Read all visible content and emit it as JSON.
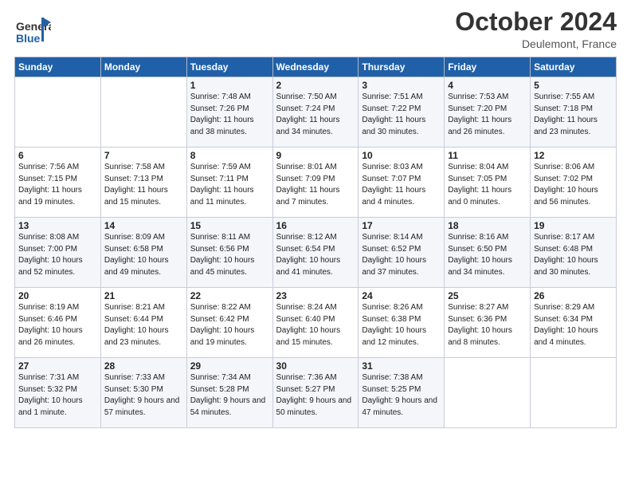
{
  "header": {
    "logo_general": "General",
    "logo_blue": "Blue",
    "month_title": "October 2024",
    "location": "Deulemont, France"
  },
  "weekdays": [
    "Sunday",
    "Monday",
    "Tuesday",
    "Wednesday",
    "Thursday",
    "Friday",
    "Saturday"
  ],
  "weeks": [
    [
      {
        "day": "",
        "sunrise": "",
        "sunset": "",
        "daylight": ""
      },
      {
        "day": "",
        "sunrise": "",
        "sunset": "",
        "daylight": ""
      },
      {
        "day": "1",
        "sunrise": "Sunrise: 7:48 AM",
        "sunset": "Sunset: 7:26 PM",
        "daylight": "Daylight: 11 hours and 38 minutes."
      },
      {
        "day": "2",
        "sunrise": "Sunrise: 7:50 AM",
        "sunset": "Sunset: 7:24 PM",
        "daylight": "Daylight: 11 hours and 34 minutes."
      },
      {
        "day": "3",
        "sunrise": "Sunrise: 7:51 AM",
        "sunset": "Sunset: 7:22 PM",
        "daylight": "Daylight: 11 hours and 30 minutes."
      },
      {
        "day": "4",
        "sunrise": "Sunrise: 7:53 AM",
        "sunset": "Sunset: 7:20 PM",
        "daylight": "Daylight: 11 hours and 26 minutes."
      },
      {
        "day": "5",
        "sunrise": "Sunrise: 7:55 AM",
        "sunset": "Sunset: 7:18 PM",
        "daylight": "Daylight: 11 hours and 23 minutes."
      }
    ],
    [
      {
        "day": "6",
        "sunrise": "Sunrise: 7:56 AM",
        "sunset": "Sunset: 7:15 PM",
        "daylight": "Daylight: 11 hours and 19 minutes."
      },
      {
        "day": "7",
        "sunrise": "Sunrise: 7:58 AM",
        "sunset": "Sunset: 7:13 PM",
        "daylight": "Daylight: 11 hours and 15 minutes."
      },
      {
        "day": "8",
        "sunrise": "Sunrise: 7:59 AM",
        "sunset": "Sunset: 7:11 PM",
        "daylight": "Daylight: 11 hours and 11 minutes."
      },
      {
        "day": "9",
        "sunrise": "Sunrise: 8:01 AM",
        "sunset": "Sunset: 7:09 PM",
        "daylight": "Daylight: 11 hours and 7 minutes."
      },
      {
        "day": "10",
        "sunrise": "Sunrise: 8:03 AM",
        "sunset": "Sunset: 7:07 PM",
        "daylight": "Daylight: 11 hours and 4 minutes."
      },
      {
        "day": "11",
        "sunrise": "Sunrise: 8:04 AM",
        "sunset": "Sunset: 7:05 PM",
        "daylight": "Daylight: 11 hours and 0 minutes."
      },
      {
        "day": "12",
        "sunrise": "Sunrise: 8:06 AM",
        "sunset": "Sunset: 7:02 PM",
        "daylight": "Daylight: 10 hours and 56 minutes."
      }
    ],
    [
      {
        "day": "13",
        "sunrise": "Sunrise: 8:08 AM",
        "sunset": "Sunset: 7:00 PM",
        "daylight": "Daylight: 10 hours and 52 minutes."
      },
      {
        "day": "14",
        "sunrise": "Sunrise: 8:09 AM",
        "sunset": "Sunset: 6:58 PM",
        "daylight": "Daylight: 10 hours and 49 minutes."
      },
      {
        "day": "15",
        "sunrise": "Sunrise: 8:11 AM",
        "sunset": "Sunset: 6:56 PM",
        "daylight": "Daylight: 10 hours and 45 minutes."
      },
      {
        "day": "16",
        "sunrise": "Sunrise: 8:12 AM",
        "sunset": "Sunset: 6:54 PM",
        "daylight": "Daylight: 10 hours and 41 minutes."
      },
      {
        "day": "17",
        "sunrise": "Sunrise: 8:14 AM",
        "sunset": "Sunset: 6:52 PM",
        "daylight": "Daylight: 10 hours and 37 minutes."
      },
      {
        "day": "18",
        "sunrise": "Sunrise: 8:16 AM",
        "sunset": "Sunset: 6:50 PM",
        "daylight": "Daylight: 10 hours and 34 minutes."
      },
      {
        "day": "19",
        "sunrise": "Sunrise: 8:17 AM",
        "sunset": "Sunset: 6:48 PM",
        "daylight": "Daylight: 10 hours and 30 minutes."
      }
    ],
    [
      {
        "day": "20",
        "sunrise": "Sunrise: 8:19 AM",
        "sunset": "Sunset: 6:46 PM",
        "daylight": "Daylight: 10 hours and 26 minutes."
      },
      {
        "day": "21",
        "sunrise": "Sunrise: 8:21 AM",
        "sunset": "Sunset: 6:44 PM",
        "daylight": "Daylight: 10 hours and 23 minutes."
      },
      {
        "day": "22",
        "sunrise": "Sunrise: 8:22 AM",
        "sunset": "Sunset: 6:42 PM",
        "daylight": "Daylight: 10 hours and 19 minutes."
      },
      {
        "day": "23",
        "sunrise": "Sunrise: 8:24 AM",
        "sunset": "Sunset: 6:40 PM",
        "daylight": "Daylight: 10 hours and 15 minutes."
      },
      {
        "day": "24",
        "sunrise": "Sunrise: 8:26 AM",
        "sunset": "Sunset: 6:38 PM",
        "daylight": "Daylight: 10 hours and 12 minutes."
      },
      {
        "day": "25",
        "sunrise": "Sunrise: 8:27 AM",
        "sunset": "Sunset: 6:36 PM",
        "daylight": "Daylight: 10 hours and 8 minutes."
      },
      {
        "day": "26",
        "sunrise": "Sunrise: 8:29 AM",
        "sunset": "Sunset: 6:34 PM",
        "daylight": "Daylight: 10 hours and 4 minutes."
      }
    ],
    [
      {
        "day": "27",
        "sunrise": "Sunrise: 7:31 AM",
        "sunset": "Sunset: 5:32 PM",
        "daylight": "Daylight: 10 hours and 1 minute."
      },
      {
        "day": "28",
        "sunrise": "Sunrise: 7:33 AM",
        "sunset": "Sunset: 5:30 PM",
        "daylight": "Daylight: 9 hours and 57 minutes."
      },
      {
        "day": "29",
        "sunrise": "Sunrise: 7:34 AM",
        "sunset": "Sunset: 5:28 PM",
        "daylight": "Daylight: 9 hours and 54 minutes."
      },
      {
        "day": "30",
        "sunrise": "Sunrise: 7:36 AM",
        "sunset": "Sunset: 5:27 PM",
        "daylight": "Daylight: 9 hours and 50 minutes."
      },
      {
        "day": "31",
        "sunrise": "Sunrise: 7:38 AM",
        "sunset": "Sunset: 5:25 PM",
        "daylight": "Daylight: 9 hours and 47 minutes."
      },
      {
        "day": "",
        "sunrise": "",
        "sunset": "",
        "daylight": ""
      },
      {
        "day": "",
        "sunrise": "",
        "sunset": "",
        "daylight": ""
      }
    ]
  ]
}
